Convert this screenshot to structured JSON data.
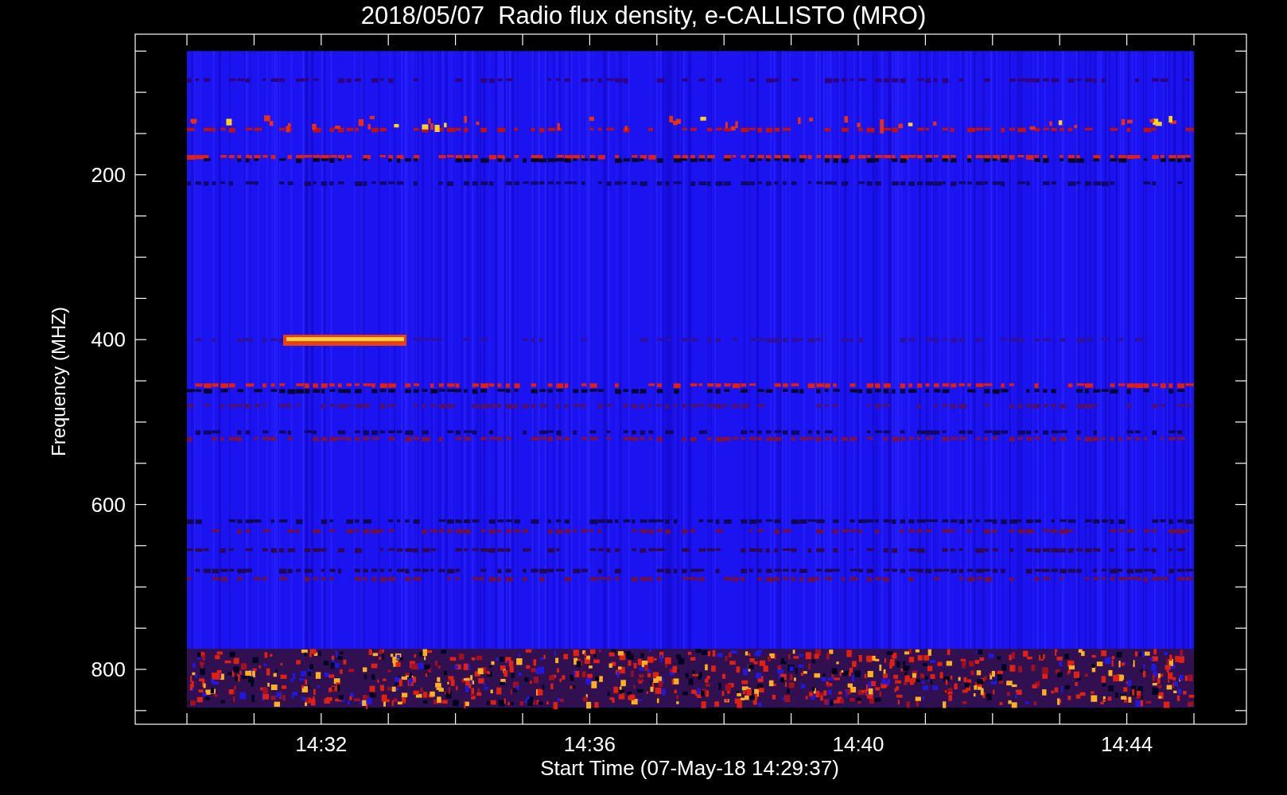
{
  "title": "2018/05/07  Radio flux density, e-CALLISTO (MRO)",
  "y_axis": {
    "label": "Frequency (MHZ)",
    "tick_labels": [
      "200",
      "400",
      "600",
      "800"
    ]
  },
  "x_axis": {
    "label": "Start Time (07-May-18 14:29:37)",
    "tick_labels": [
      "14:32",
      "14:36",
      "14:40",
      "14:44"
    ]
  }
}
